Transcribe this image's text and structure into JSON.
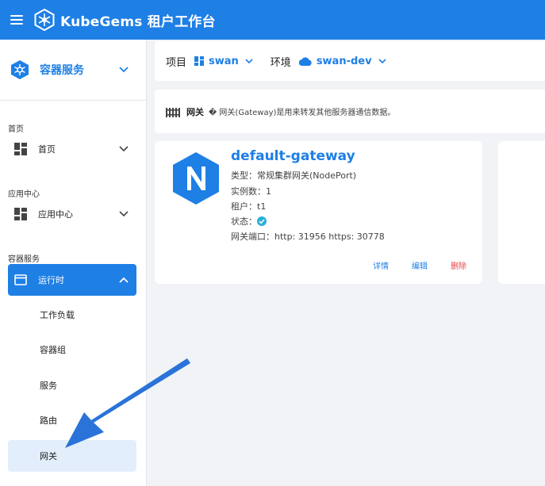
{
  "app": {
    "title": "KubeGems 租户工作台"
  },
  "sidebar": {
    "module": "容器服务",
    "groups": [
      {
        "label": "首页",
        "item": "首页"
      },
      {
        "label": "应用中心",
        "item": "应用中心"
      },
      {
        "label": "容器服务",
        "item": "运行时"
      }
    ],
    "sub_items": [
      "工作负载",
      "容器组",
      "服务",
      "路由",
      "网关"
    ]
  },
  "filter": {
    "project_label": "项目",
    "project_value": "swan",
    "env_label": "环境",
    "env_value": "swan-dev"
  },
  "gateway_header": {
    "name": "网关",
    "description": "� 网关(Gateway)是用来转发其他服务器通信数据。"
  },
  "card": {
    "title": "default-gateway",
    "type_line": "类型：常规集群网关(NodePort)",
    "replicas_line": "实例数：1",
    "tenant_line": "租户：t1",
    "status_label": "状态：",
    "ports_line": "网关端口：http: 31956 https: 30778",
    "actions": {
      "detail": "详情",
      "edit": "编辑",
      "delete": "删除"
    }
  },
  "colors": {
    "primary": "#1e7fe5",
    "danger": "#e54545",
    "status_ok": "#2ab0d8"
  }
}
